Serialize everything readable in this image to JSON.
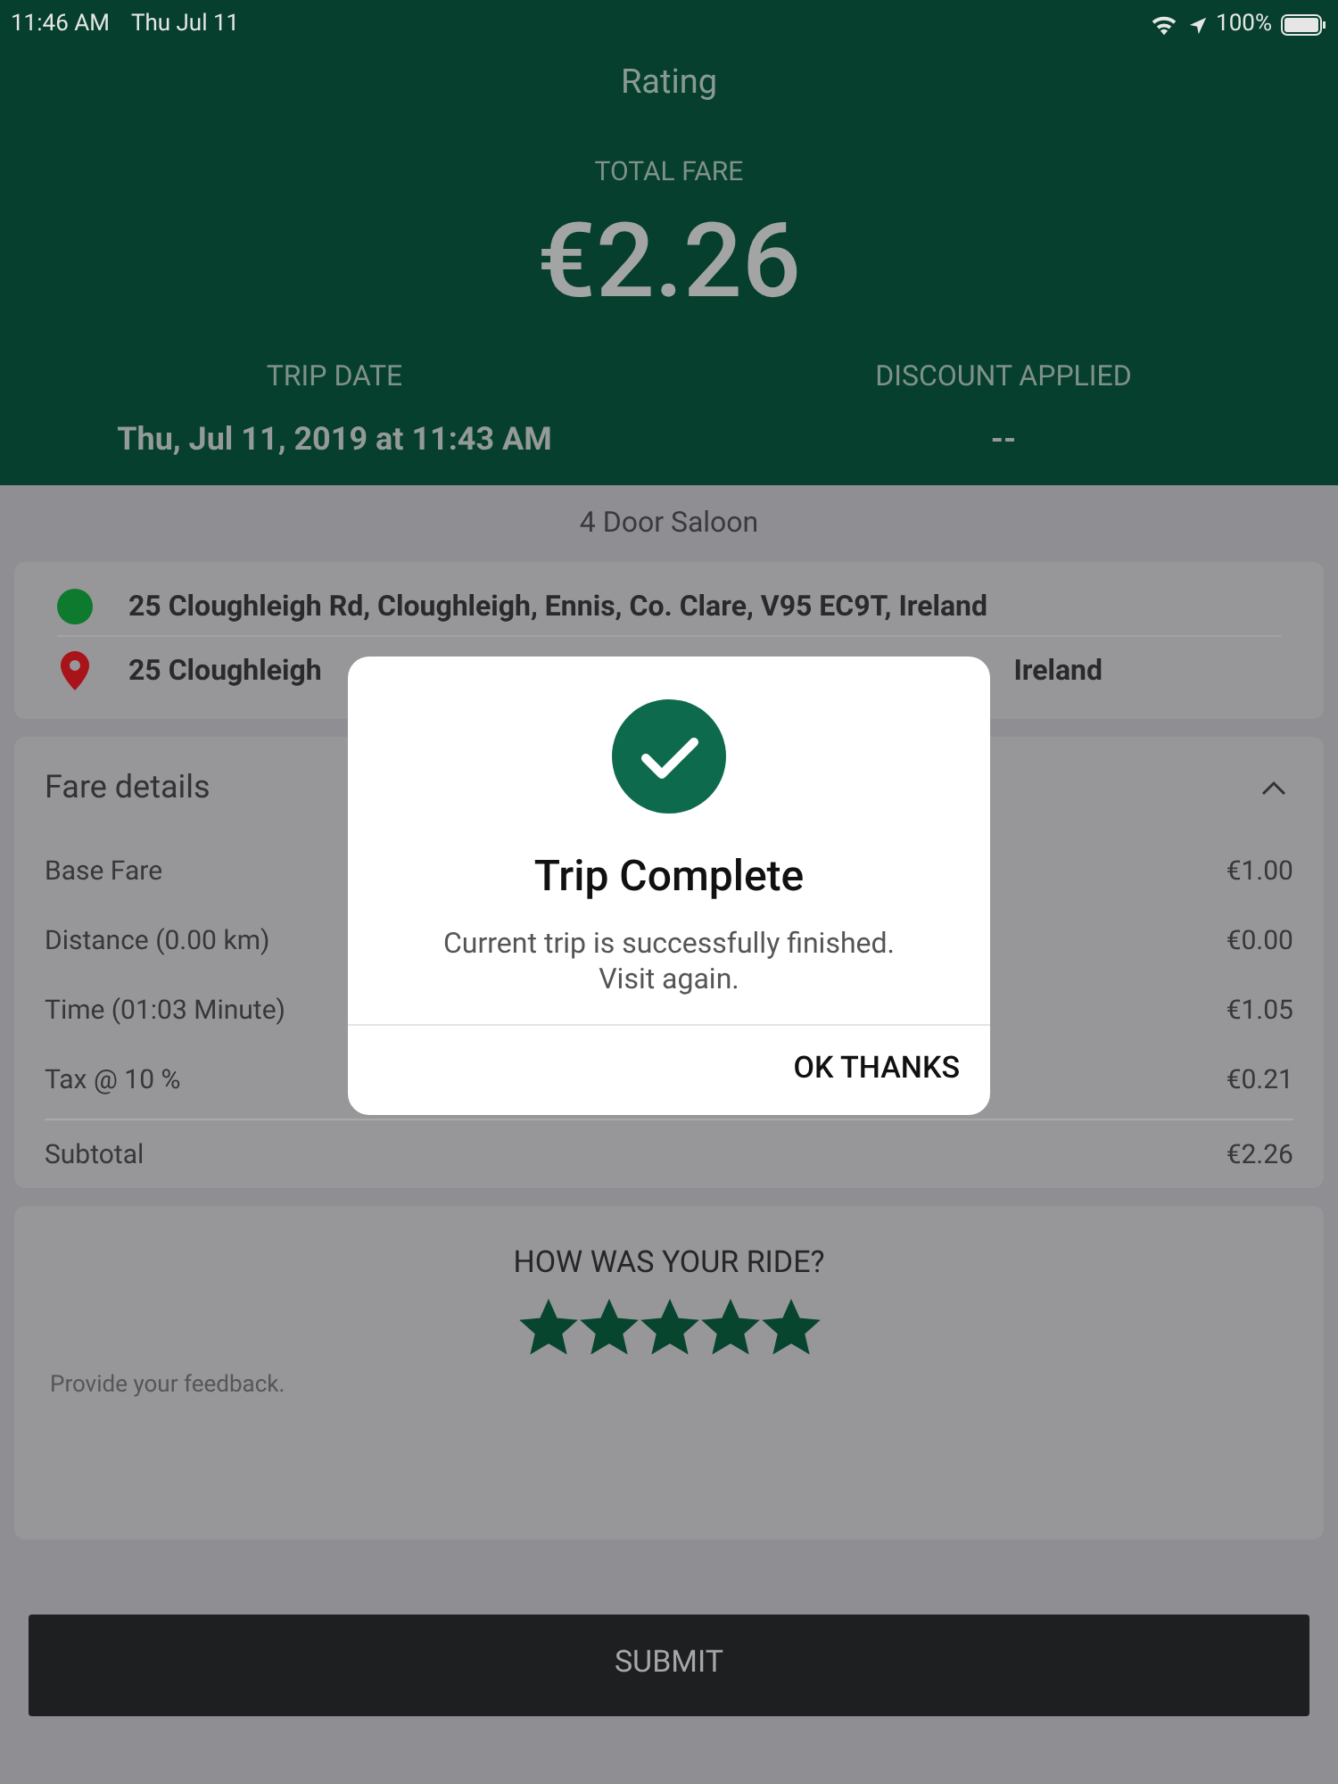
{
  "status_bar": {
    "time": "11:46 AM",
    "date": "Thu Jul 11",
    "battery": "100%"
  },
  "header": {
    "title": "Rating",
    "total_label": "TOTAL FARE",
    "total": "€2.26",
    "trip_date_label": "TRIP DATE",
    "trip_date": "Thu, Jul 11, 2019 at 11:43 AM",
    "discount_label": "DISCOUNT APPLIED",
    "discount": "--"
  },
  "vehicle": "4 Door Saloon",
  "route": {
    "pickup": "25 Cloughleigh Rd,  Cloughleigh,  Ennis,  Co. Clare,  V95 EC9T,  Ireland",
    "dropoff_start": "25 Cloughleigh",
    "dropoff_end": "Ireland"
  },
  "fare_details": {
    "title": "Fare details",
    "expanded": true,
    "rows": [
      {
        "label": "Base Fare",
        "value": "€1.00"
      },
      {
        "label": "Distance (0.00 km)",
        "value": "€0.00"
      },
      {
        "label": "Time (01:03 Minute)",
        "value": "€1.05"
      },
      {
        "label": "Tax @ 10 %",
        "value": "€0.21"
      },
      {
        "label": "Subtotal",
        "value": "€2.26",
        "kind": "total"
      }
    ]
  },
  "rating": {
    "question": "HOW WAS YOUR RIDE?",
    "stars": 5,
    "feedback_placeholder": "Provide your feedback."
  },
  "submit": "SUBMIT",
  "dialog": {
    "title": "Trip Complete",
    "message": "Current trip is successfully finished.\nVisit again.",
    "button": "OK THANKS"
  }
}
